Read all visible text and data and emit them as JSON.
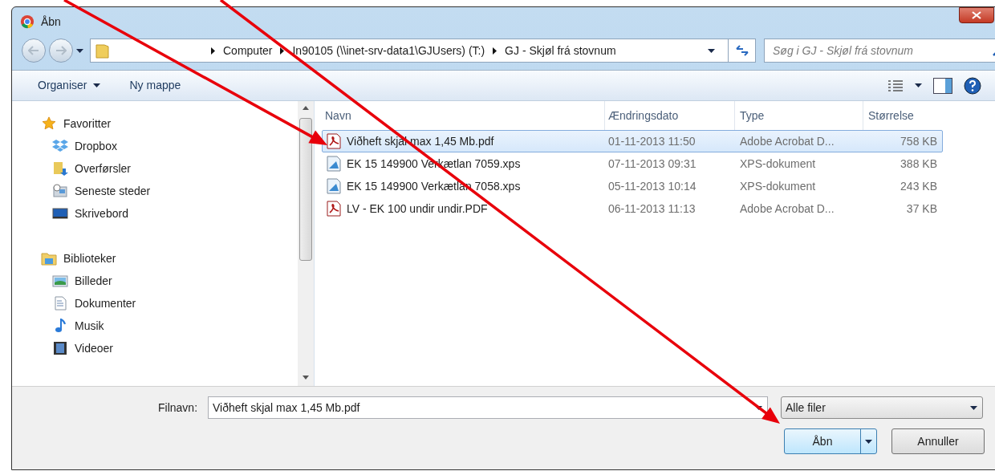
{
  "window": {
    "title": "Åbn"
  },
  "address_bar": {
    "path": [
      "Computer",
      "In90105 (\\\\inet-srv-data1\\GJUsers) (T:)",
      "GJ - Skjøl frá stovnum"
    ]
  },
  "search": {
    "placeholder": "Søg i GJ - Skjøl frá stovnum"
  },
  "toolbar": {
    "organise": "Organiser",
    "new_folder": "Ny mappe"
  },
  "sidebar": {
    "groups": [
      {
        "label": "Favoritter",
        "kind": "star",
        "children": [
          {
            "label": "Dropbox",
            "kind": "dropbox"
          },
          {
            "label": "Overførsler",
            "kind": "download"
          },
          {
            "label": "Seneste steder",
            "kind": "recent"
          },
          {
            "label": "Skrivebord",
            "kind": "desktop"
          }
        ]
      },
      {
        "label": "Biblioteker",
        "kind": "library",
        "children": [
          {
            "label": "Billeder",
            "kind": "pictures"
          },
          {
            "label": "Dokumenter",
            "kind": "documents"
          },
          {
            "label": "Musik",
            "kind": "music"
          },
          {
            "label": "Videoer",
            "kind": "videos"
          }
        ]
      }
    ]
  },
  "table": {
    "columns": [
      "Navn",
      "Ændringsdato",
      "Type",
      "Størrelse"
    ],
    "rows": [
      {
        "kind": "pdf",
        "name": "Viðheft skjal max 1,45 Mb.pdf",
        "date": "01-11-2013 11:50",
        "type": "Adobe Acrobat D...",
        "size": "758 KB",
        "selected": true
      },
      {
        "kind": "xps",
        "name": "EK 15 149900 Verkætlan 7059.xps",
        "date": "07-11-2013 09:31",
        "type": "XPS-dokument",
        "size": "388 KB",
        "selected": false
      },
      {
        "kind": "xps",
        "name": "EK 15 149900 Verkætlan 7058.xps",
        "date": "05-11-2013 10:14",
        "type": "XPS-dokument",
        "size": "243 KB",
        "selected": false
      },
      {
        "kind": "pdf",
        "name": "LV - EK 100 undir undir.PDF",
        "date": "06-11-2013 11:13",
        "type": "Adobe Acrobat D...",
        "size": "37 KB",
        "selected": false
      }
    ]
  },
  "footer": {
    "filename_label": "Filnavn:",
    "filename_value": "Viðheft skjal max 1,45 Mb.pdf",
    "filetype": "Alle filer",
    "open": "Åbn",
    "cancel": "Annuller"
  }
}
